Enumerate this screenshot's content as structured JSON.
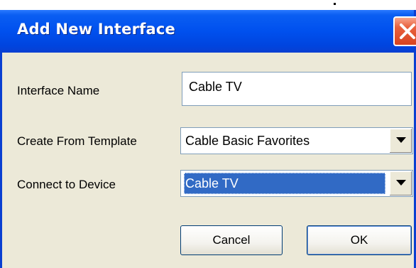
{
  "dialog": {
    "title": "Add New Interface",
    "close_icon": "close-icon"
  },
  "fields": {
    "interface_name_label": "Interface Name",
    "interface_name_value": "Cable TV",
    "template_label": "Create From Template",
    "template_value": "Cable Basic Favorites",
    "device_label": "Connect to Device",
    "device_value": "Cable TV"
  },
  "buttons": {
    "cancel": "Cancel",
    "ok": "OK"
  },
  "colors": {
    "titlebar": "#0050ee",
    "dialog_bg": "#ece9d8",
    "selection": "#316ac5",
    "close": "#d8431f"
  }
}
